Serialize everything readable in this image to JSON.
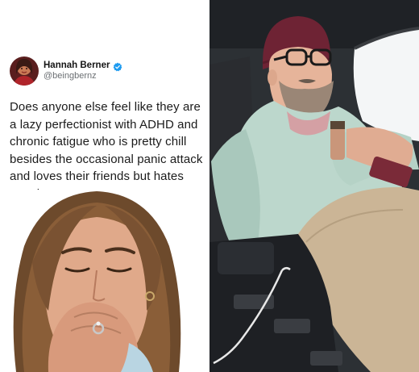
{
  "tweet": {
    "display_name": "Hannah Berner",
    "handle": "@beingbernz",
    "text": "Does anyone else feel like they are a lazy perfectionist with ADHD and chronic fatigue who is pretty chill besides the occasional panic attack and loves their friends but hates people?",
    "verified_color": "#1d9bf0"
  },
  "icons": {
    "verified": "verified-badge-icon"
  }
}
